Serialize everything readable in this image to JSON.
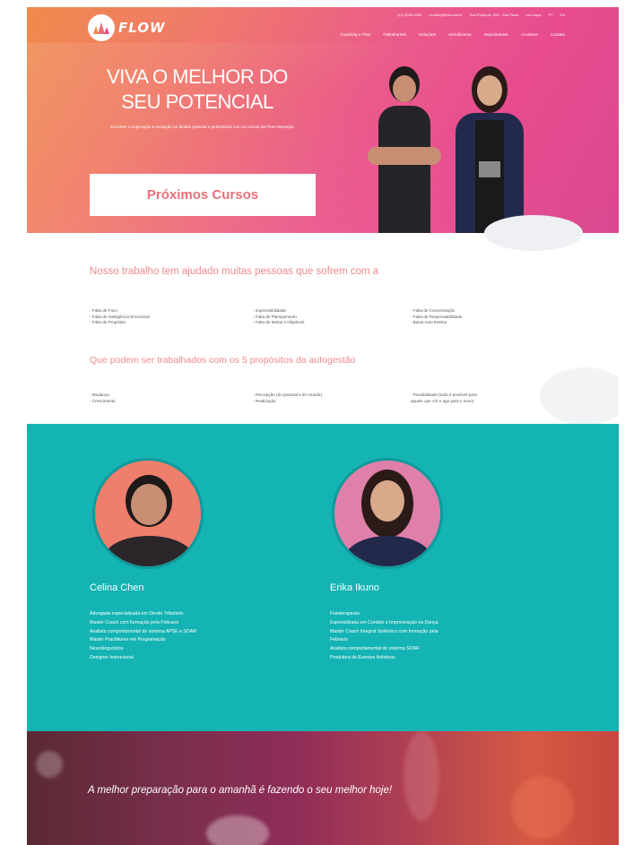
{
  "brand": {
    "logo_text": "FLOW"
  },
  "contact": [
    "(11) 0000-0000",
    "contato@flow.com.br",
    "Rua Exemplo, 000 - Sao Paulo",
    "ver mapa",
    "PT",
    "EN"
  ],
  "nav": [
    "Coaching e Flow",
    "Palestrantes",
    "Soluções",
    "Atendimento",
    "Depoimentos",
    "Acontece",
    "Contato"
  ],
  "hero": {
    "title": "VIVA O MELHOR DO SEU POTENCIAL",
    "subtitle": "Encontre a superação e evolução no âmbito pessoal e profissional com os cursos da Flow Interação.",
    "cta_label": "Próximos Cursos"
  },
  "problems": {
    "heading": "Nosso trabalho tem ajudado muitas pessoas que sofrem com a",
    "col1": [
      "- Falta de Foco",
      "- Falta de Inteligência Emocional",
      "- Falta de Propósito"
    ],
    "col2": [
      "- Imprevisibilidade",
      "- Falta de Planejamento",
      "- Falta de Metas e Objetivos"
    ],
    "col3": [
      "- Falta de Concentração",
      "- Falta de Responsabilidade",
      "- Baixa Auto Estima"
    ],
    "heading2": "Que podem ser trabalhados com os 5 propósitos da autogestão",
    "pcol1": [
      "- Mudança",
      "- Crescimento"
    ],
    "pcol2": [
      "- Percepção (do pessoal e do mundo),",
      "- Realização"
    ],
    "pcol3": [
      "- Possibilidade (tudo é possível para",
      "aquele que crê e age para o novo)"
    ]
  },
  "team": [
    {
      "name": "Celina Chen",
      "bio": [
        "Advogada especializada em Direito Tributário",
        "Master Coach com formação pela Febracis",
        "Analista comportamental do sistema APSE e SOAR",
        "Master Practitioner em Programação",
        "Neurolinguística",
        "Designer Instrucional"
      ]
    },
    {
      "name": "Erika Ikuno",
      "bio": [
        "Fisioterapeuta",
        "Especializada em Contato e Improvisação na Dança",
        "Master Coach Integral Sistêmico com formação pela",
        "Febracis",
        "Analista comportamental do sistema SOAR",
        "Produtora de Eventos Artísticos"
      ]
    }
  ],
  "banner": {
    "quote": "A melhor preparação para o amanhã é fazendo o seu melhor hoje!"
  },
  "colors": {
    "hero_orange": "#f08a4b",
    "hero_pink": "#e84c8f",
    "accent_salmon": "#f08a8e",
    "teal": "#14b3b4"
  }
}
